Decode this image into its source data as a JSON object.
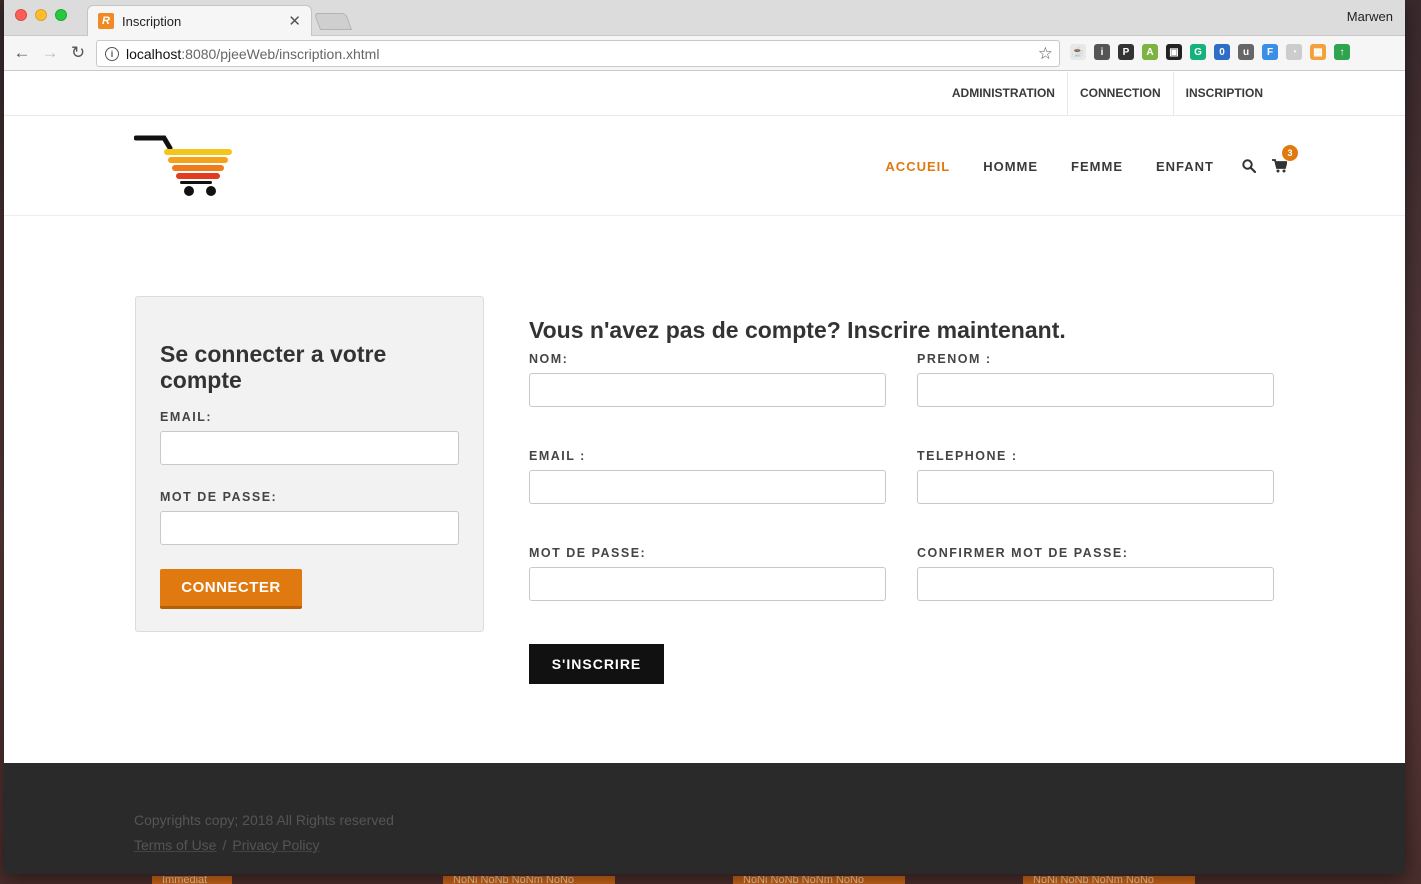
{
  "browser": {
    "tab_title": "Inscription",
    "favicon_letter": "R",
    "profile_name": "Marwen",
    "url_host": "localhost",
    "url_rest": ":8080/pjeeWeb/inscription.xhtml",
    "extensions": [
      {
        "name": "java-icon",
        "color": "#e8e8e8",
        "glyph": "☕"
      },
      {
        "name": "onepassword-icon",
        "color": "#555555",
        "glyph": "i"
      },
      {
        "name": "pocket-icon",
        "color": "#333333",
        "glyph": "P"
      },
      {
        "name": "android-icon",
        "color": "#7cb342",
        "glyph": "A"
      },
      {
        "name": "trello-icon",
        "color": "#222222",
        "glyph": "▣"
      },
      {
        "name": "grammarly-icon",
        "color": "#15b37c",
        "glyph": "G"
      },
      {
        "name": "badge-icon",
        "color": "#2e6ec7",
        "glyph": "0"
      },
      {
        "name": "ublock-icon",
        "color": "#666666",
        "glyph": "u"
      },
      {
        "name": "ft-icon",
        "color": "#3a8ee6",
        "glyph": "F"
      },
      {
        "name": "ghost-icon",
        "color": "#cccccc",
        "glyph": "◔"
      },
      {
        "name": "grid-icon",
        "color": "#f2a23c",
        "glyph": "▦"
      },
      {
        "name": "upload-icon",
        "color": "#2ea44f",
        "glyph": "↑"
      }
    ]
  },
  "topbar": {
    "links": [
      "ADMINISTRATION",
      "CONNECTION",
      "INSCRIPTION"
    ]
  },
  "nav": {
    "items": [
      "ACCUEIL",
      "HOMME",
      "FEMME",
      "ENFANT"
    ],
    "active_index": 0,
    "cart_count": "3",
    "accent_color": "#e07a10"
  },
  "login": {
    "title": "Se connecter a votre compte",
    "email_label": "EMAIL:",
    "email_value": "",
    "password_label": "MOT DE PASSE:",
    "password_value": "",
    "button_label": "CONNECTER"
  },
  "register": {
    "title": "Vous n'avez pas de compte? Inscrire maintenant.",
    "fields": [
      {
        "label": "NOM:",
        "value": ""
      },
      {
        "label": "PRENOM :",
        "value": ""
      },
      {
        "label": "EMAIL :",
        "value": ""
      },
      {
        "label": "TELEPHONE :",
        "value": ""
      },
      {
        "label": "MOT DE PASSE:",
        "value": ""
      },
      {
        "label": "CONFIRMER MOT DE PASSE:",
        "value": ""
      }
    ],
    "button_label": "S'INSCRIRE"
  },
  "footer": {
    "copyright": "Copyrights copy; 2018 All Rights reserved",
    "terms": "Terms of Use",
    "separator": "/",
    "privacy": "Privacy Policy"
  },
  "peek_labels": [
    "Immediat",
    "NoNi NoNb NoNm NoNo",
    "NoNi NoNb NoNm NoNo",
    "NoNi NoNb NoNm NoNo"
  ]
}
